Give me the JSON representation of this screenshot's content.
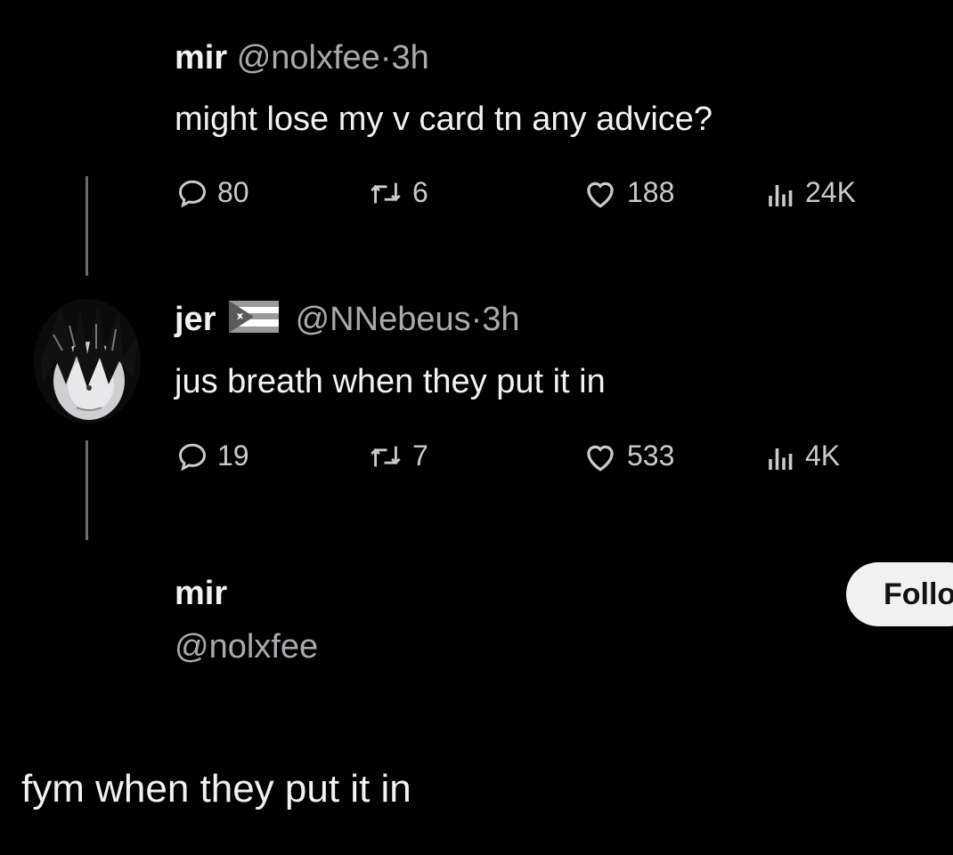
{
  "tweet1": {
    "name": "mir",
    "handle": "@nolxfee",
    "separator": "·",
    "time": "3h",
    "text": "might lose my v card tn any advice?",
    "replies": "80",
    "retweets": "6",
    "likes": "188",
    "views": "24K"
  },
  "tweet2": {
    "name": "jer",
    "flag_icon": "puerto-rico-flag-icon",
    "handle": "@NNebeus",
    "separator": "·",
    "time": "3h",
    "text": "jus breath when they put it in",
    "replies": "19",
    "retweets": "7",
    "likes": "533",
    "views": "4K"
  },
  "profile": {
    "name": "mir",
    "handle": "@nolxfee",
    "follow_label": "Follow"
  },
  "caption": "fym when they put it in",
  "colors": {
    "background": "#000000",
    "text": "#e7e9ea",
    "muted": "#a8aaad",
    "thread_line": "#6a6a6a",
    "button_bg": "#f1f1f1"
  }
}
